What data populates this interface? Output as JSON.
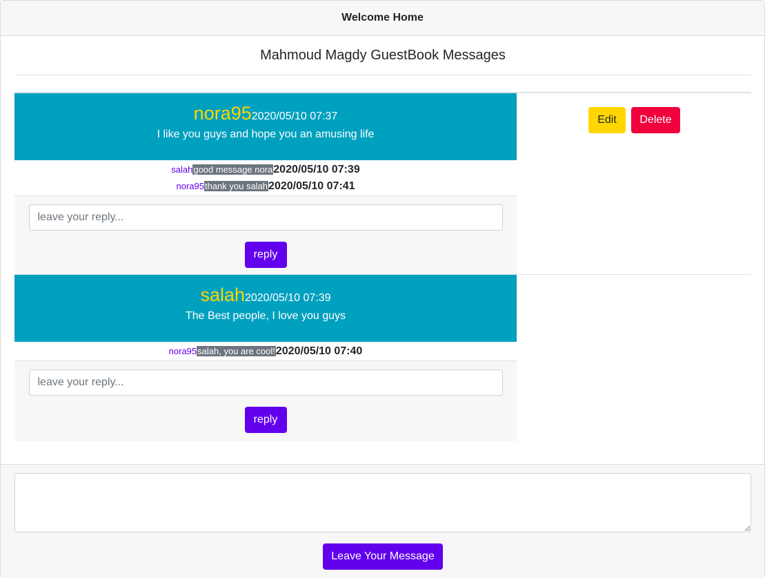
{
  "header": {
    "title": "Welcome Home"
  },
  "page": {
    "title": "Mahmoud Magdy GuestBook Messages"
  },
  "messages": [
    {
      "author": "nora95",
      "date": "2020/05/10 07:37",
      "text": "I like you guys and hope you an amusing life",
      "replies": [
        {
          "author": "salah",
          "text": "good message nora",
          "date": "2020/05/10 07:39"
        },
        {
          "author": "nora95",
          "text": "thank you salah",
          "date": "2020/05/10 07:41"
        }
      ],
      "reply_placeholder": "leave your reply...",
      "reply_button": "reply"
    },
    {
      "author": "salah",
      "date": "2020/05/10 07:39",
      "text": "The Best people, I love you guys",
      "replies": [
        {
          "author": "nora95",
          "text": "salah, you are cool!",
          "date": "2020/05/10 07:40"
        }
      ],
      "reply_placeholder": "leave your reply...",
      "reply_button": "reply"
    }
  ],
  "actions": {
    "edit_label": "Edit",
    "delete_label": "Delete"
  },
  "footer": {
    "message_value": "",
    "submit_label": "Leave Your Message"
  },
  "colors": {
    "primary": "#6200ee",
    "message_header_bg": "#00a0bf",
    "author_color": "#ffd600",
    "edit_button": "#ffd600",
    "delete_button": "#f0003c",
    "reply_badge": "#6c757d"
  }
}
